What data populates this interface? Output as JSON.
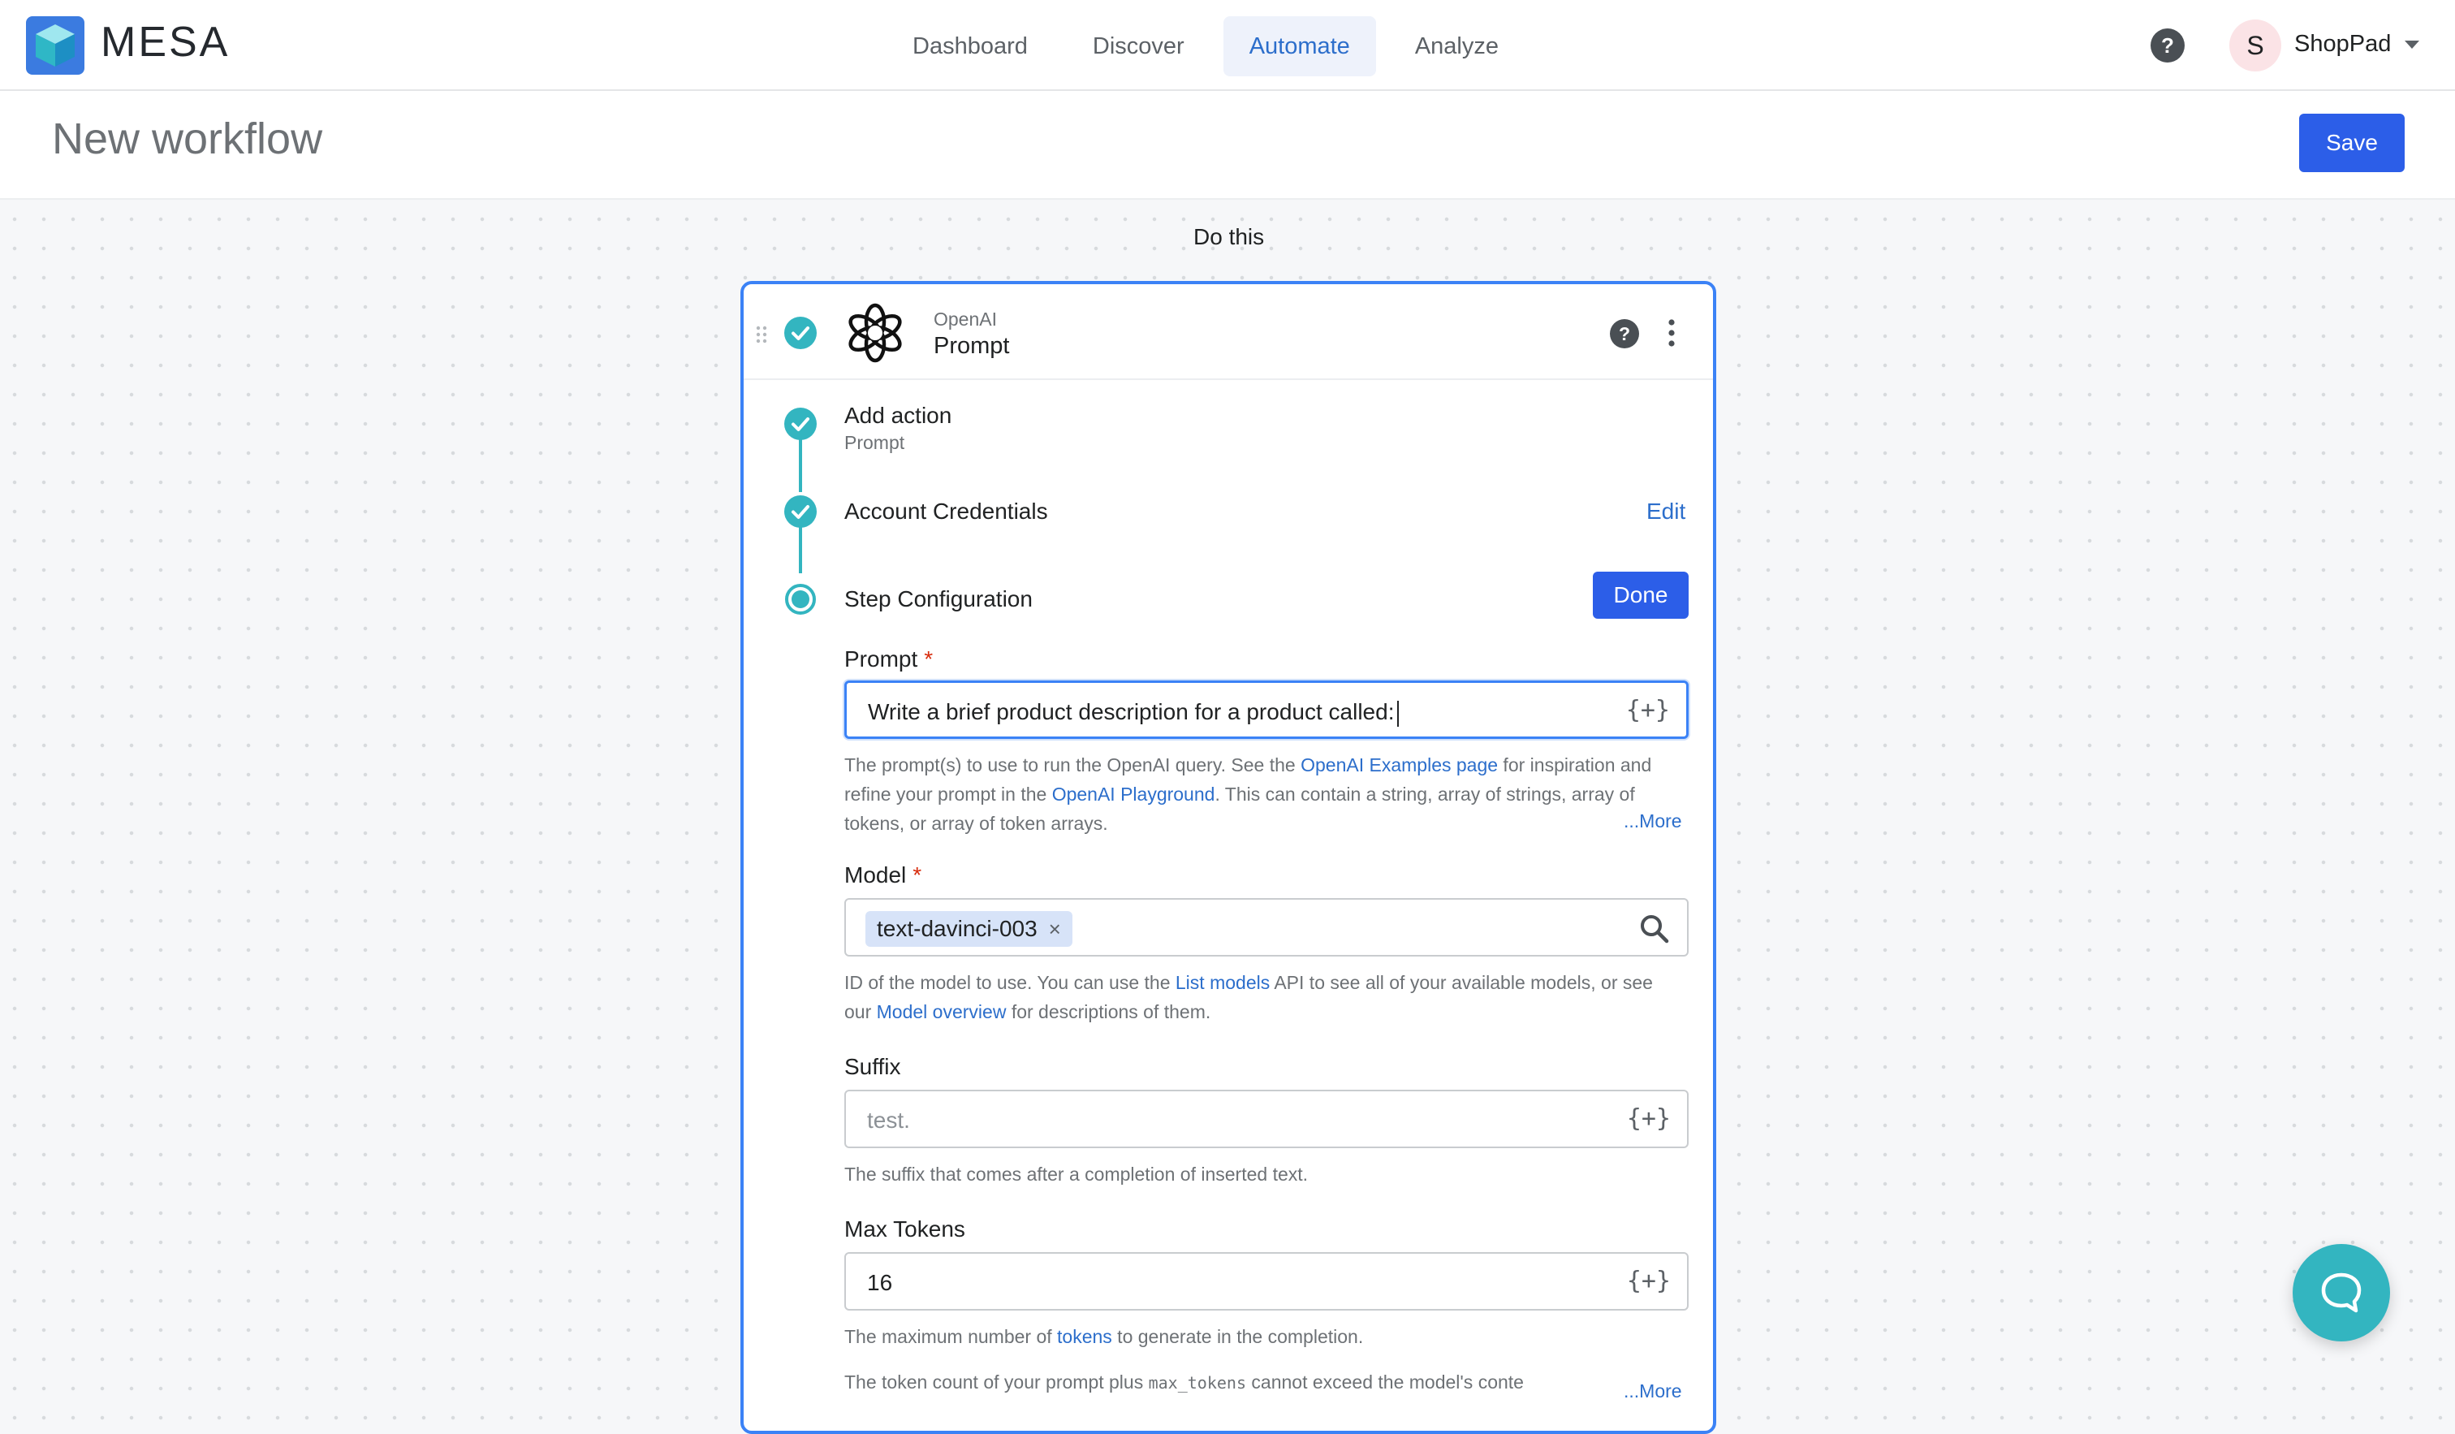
{
  "app": {
    "name": "MESA"
  },
  "nav": {
    "items": [
      "Dashboard",
      "Discover",
      "Automate",
      "Analyze"
    ],
    "active": "Automate"
  },
  "account": {
    "initial": "S",
    "name": "ShopPad"
  },
  "page": {
    "title": "New workflow",
    "save_label": "Save"
  },
  "canvas": {
    "section_label": "Do this"
  },
  "card": {
    "app_name": "OpenAI",
    "action_name": "Prompt",
    "steps": [
      {
        "label": "Add action",
        "sub": "Prompt",
        "status": "complete"
      },
      {
        "label": "Account Credentials",
        "action": "Edit",
        "status": "complete"
      },
      {
        "label": "Step Configuration",
        "action": "Done",
        "status": "current"
      }
    ],
    "fields": {
      "prompt": {
        "label": "Prompt",
        "required_mark": "*",
        "value": "Write a brief product description for a product called:",
        "help_1": "The prompt(s) to use to run the OpenAI query. See the ",
        "help_link_1": "OpenAI Examples page",
        "help_2": " for inspiration and refine your prompt in the ",
        "help_link_2": "OpenAI Playground",
        "help_3": ". This can contain a string, array of strings, array of tokens, or array of token arrays.",
        "more": "...More"
      },
      "model": {
        "label": "Model",
        "required_mark": "*",
        "tag": "text-davinci-003",
        "tag_remove": "×",
        "help_1": "ID of the model to use. You can use the ",
        "help_link_1": "List models",
        "help_2": " API to see all of your available models, or see our ",
        "help_link_2": "Model overview",
        "help_3": " for descriptions of them."
      },
      "suffix": {
        "label": "Suffix",
        "placeholder": "test.",
        "help": "The suffix that comes after a completion of inserted text."
      },
      "max_tokens": {
        "label": "Max Tokens",
        "value": "16",
        "help_1": "The maximum number of ",
        "help_link_1": "tokens",
        "help_2": " to generate in the completion.",
        "help_extra_1": "The token count of your prompt plus ",
        "help_extra_code": "max_tokens",
        "help_extra_2": " cannot exceed the model's conte",
        "more": "...More"
      }
    },
    "variable_button": "{+}"
  },
  "colors": {
    "accent": "#2c5ee8",
    "teal": "#33b5c0",
    "link": "#2c6ecb",
    "focus": "#3b82f6"
  }
}
